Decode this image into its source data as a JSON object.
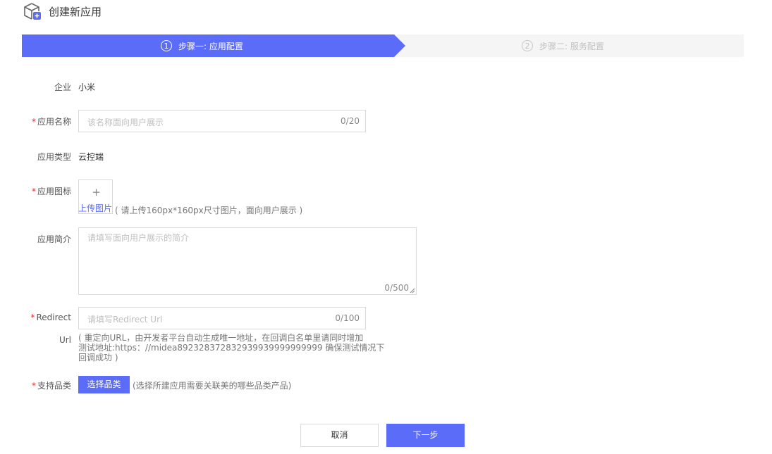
{
  "header": {
    "title": "创建新应用",
    "icon": "app-box-add-icon"
  },
  "steps": [
    {
      "number": "1",
      "label": "步骤一: 应用配置",
      "active": true
    },
    {
      "number": "2",
      "label": "步骤二: 服务配置",
      "active": false
    }
  ],
  "form": {
    "company": {
      "label": "企业",
      "value": "小米"
    },
    "app_name": {
      "required_mark": "*",
      "label": "应用名称",
      "placeholder": "该名称面向用户展示",
      "counter": "0/20"
    },
    "app_type": {
      "label": "应用类型",
      "value": "云控端"
    },
    "app_icon": {
      "required_mark": "*",
      "label": "应用图标",
      "plus": "+",
      "upload_label": "上传图片",
      "hint": "( 请上传160px*160px尺寸图片，面向用户展示 )"
    },
    "app_intro": {
      "label": "应用简介",
      "placeholder": "请填写面向用户展示的简介",
      "counter": "0/500"
    },
    "redirect": {
      "required_mark": "*",
      "label_line1": "Redirect",
      "label_line2": "Url",
      "placeholder": "请填写Redirect Url",
      "counter": "0/100",
      "hint_line1": "( 重定向URL，由开发者平台自动生成唯一地址，在回调白名单里请同时增加",
      "hint_line2": "测试地址:https：//midea892328372832939939999999999 确保测试情况下",
      "hint_line3": "回调成功 )"
    },
    "category": {
      "required_mark": "*",
      "label": "支持品类",
      "button": "选择品类",
      "hint": "(选择所建应用需要关联美的哪些品类产品)"
    }
  },
  "actions": {
    "cancel": "取消",
    "next": "下一步"
  },
  "colors": {
    "accent": "#5b6cf9",
    "required": "#f5222d"
  }
}
